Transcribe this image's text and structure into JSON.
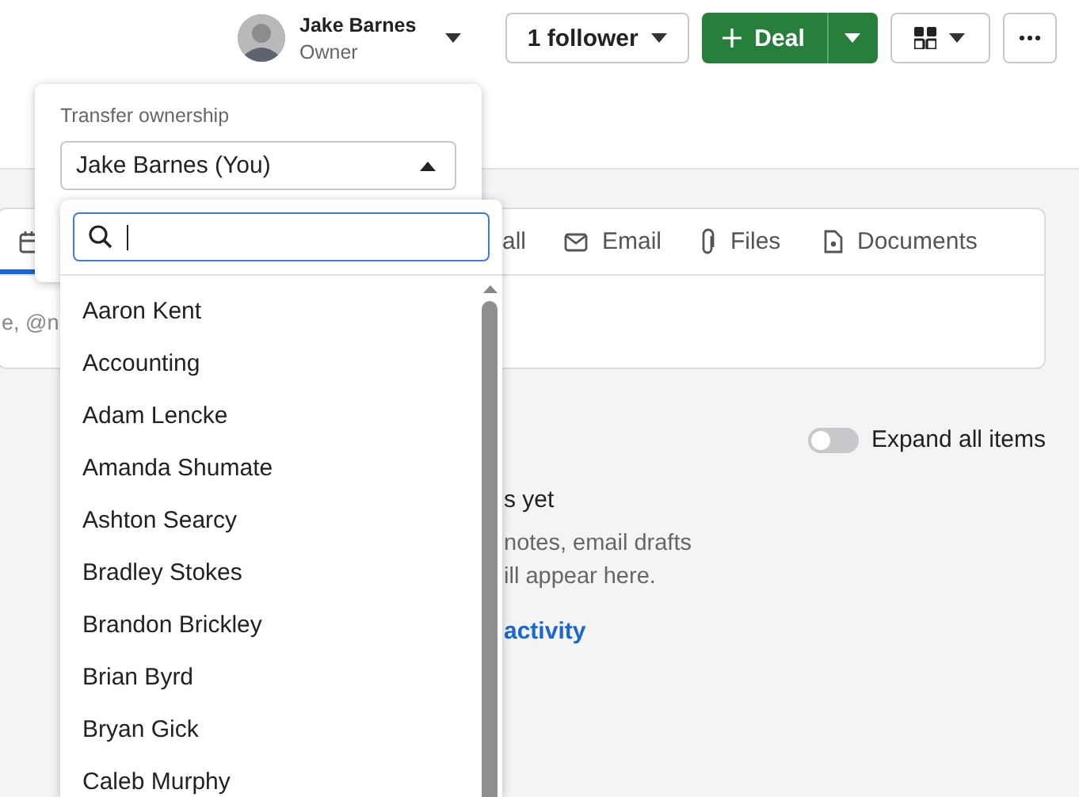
{
  "header": {
    "owner": {
      "name": "Jake Barnes",
      "role": "Owner"
    },
    "follower_button": "1 follower",
    "deal_button": "Deal"
  },
  "activity_tabs": [
    {
      "kind": "calendar",
      "selected": true
    },
    {
      "kind": "call",
      "label": "all",
      "selected": false
    },
    {
      "kind": "email",
      "label": "Email",
      "selected": false
    },
    {
      "kind": "files",
      "label": "Files",
      "selected": false
    },
    {
      "kind": "documents",
      "label": "Documents",
      "selected": false
    }
  ],
  "composer": {
    "placeholder": "e, @n"
  },
  "expand_toggle": {
    "label": "Expand all items",
    "on": false
  },
  "empty_state": {
    "title": "s yet",
    "lines": [
      "notes, email drafts",
      "ill appear here."
    ],
    "link": "activity"
  },
  "transfer_popover": {
    "label": "Transfer ownership",
    "value": "Jake Barnes (You)",
    "expanded": true
  },
  "owner_options": [
    "Aaron Kent",
    "Accounting",
    "Adam Lencke",
    "Amanda Shumate",
    "Ashton Searcy",
    "Bradley Stokes",
    "Brandon Brickley",
    "Brian Byrd",
    "Bryan Gick",
    "Caleb Murphy"
  ]
}
